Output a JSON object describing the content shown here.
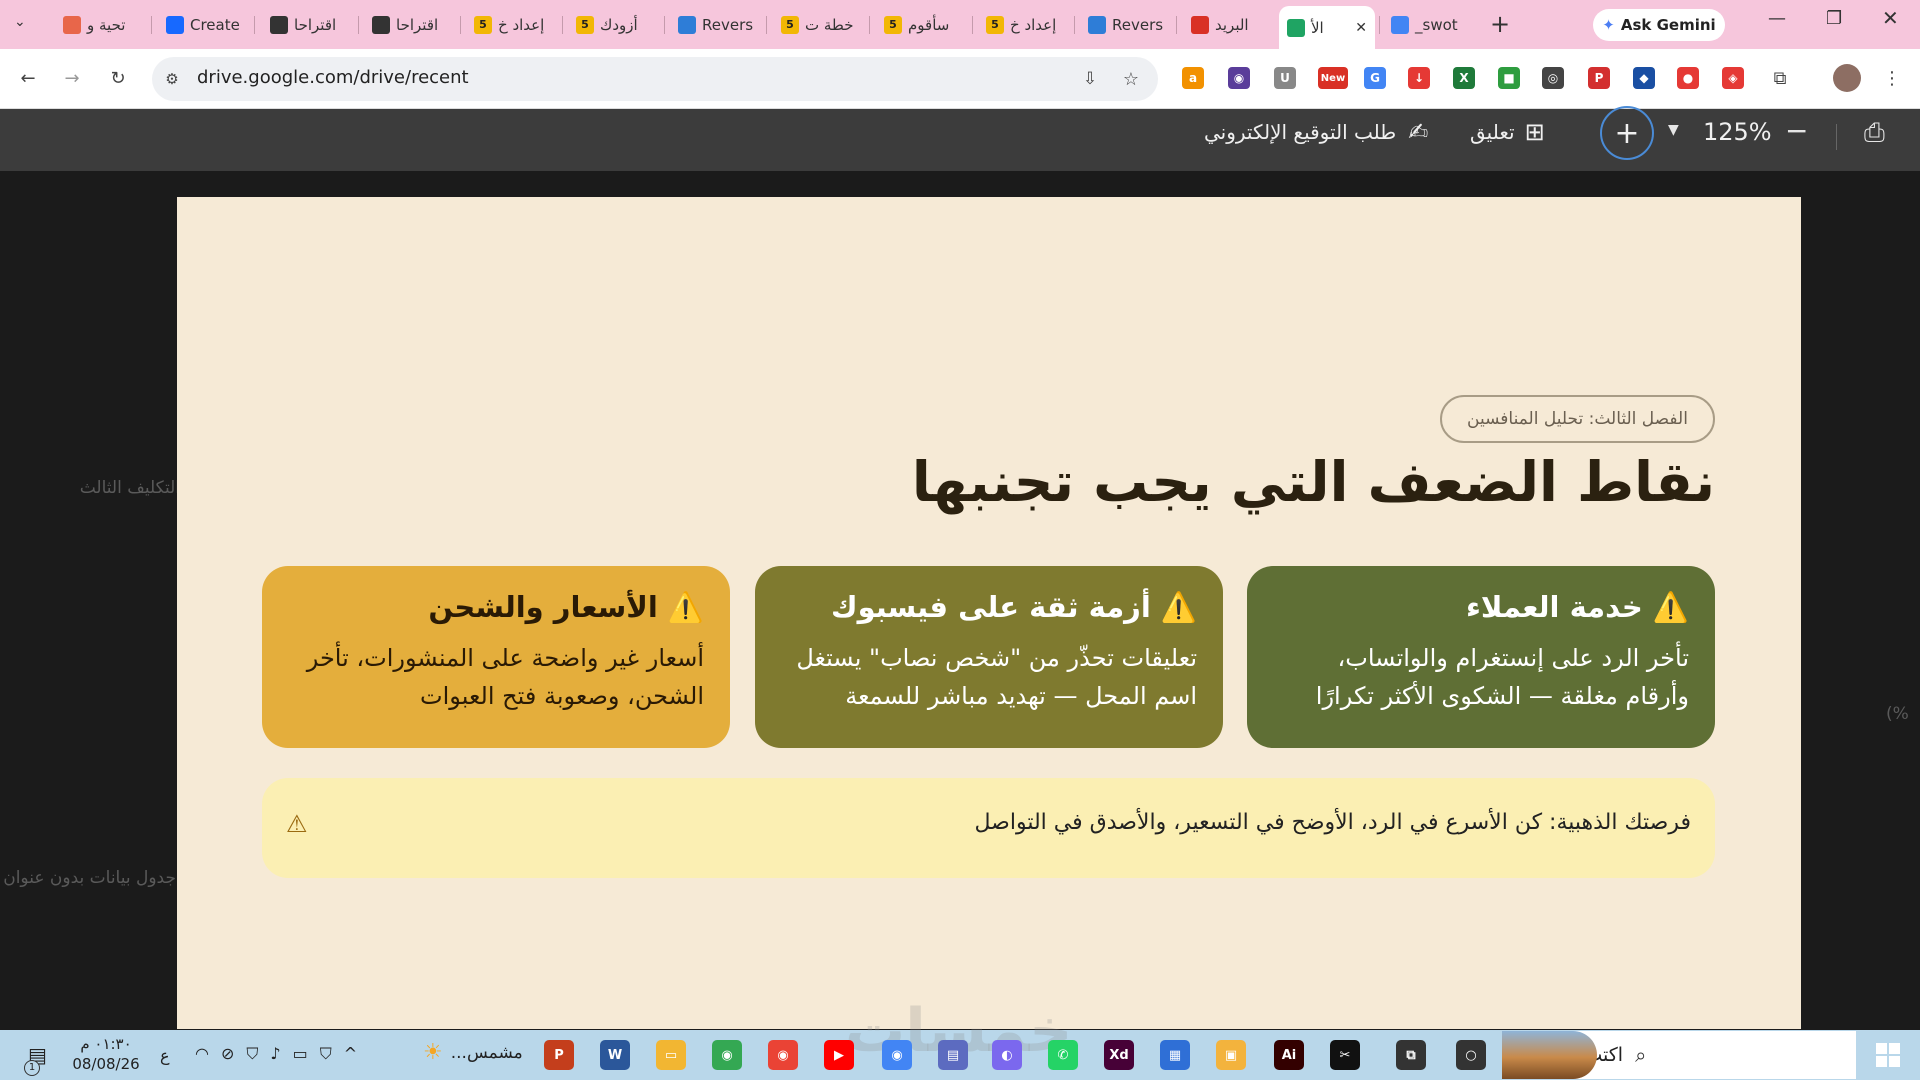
{
  "browser": {
    "tabs": [
      {
        "label": "تحية و",
        "icon": "sparkle-icon",
        "color": "#e8664a"
      },
      {
        "label": "Create",
        "icon": "behance-icon",
        "color": "#1769ff"
      },
      {
        "label": "اقتراحا",
        "icon": "openai-icon",
        "color": "#333333"
      },
      {
        "label": "اقتراحا",
        "icon": "openai-icon",
        "color": "#333333"
      },
      {
        "label": "إعداد خ",
        "icon": "five-icon",
        "color": "#f2b705"
      },
      {
        "label": "أزودك",
        "icon": "five-icon",
        "color": "#f2b705"
      },
      {
        "label": "Revers",
        "icon": "reverso-icon",
        "color": "#2e7dd7"
      },
      {
        "label": "خطة ت",
        "icon": "five-icon",
        "color": "#f2b705"
      },
      {
        "label": "سأقوم",
        "icon": "five-icon",
        "color": "#f2b705"
      },
      {
        "label": "إعداد خ",
        "icon": "five-icon",
        "color": "#f2b705"
      },
      {
        "label": "Revers",
        "icon": "reverso-icon",
        "color": "#2e7dd7"
      },
      {
        "label": "البريد",
        "icon": "gmail-icon",
        "color": "#d93025"
      },
      {
        "label": "الأ",
        "icon": "drive-icon",
        "color": "#1fa463",
        "active": true
      },
      {
        "label": "swot_",
        "icon": "docs-icon",
        "color": "#4285f4"
      }
    ],
    "five_glyph": "5",
    "new_tab_glyph": "+",
    "gemini_label": "Ask Gemini",
    "url": "drive.google.com/drive/recent",
    "extensions": [
      {
        "name": "amazon-extension-icon",
        "glyph": "a",
        "color": "#f29100"
      },
      {
        "name": "record-extension-icon",
        "glyph": "◉",
        "color": "#5a3d9a"
      },
      {
        "name": "u-extension-icon",
        "glyph": "U",
        "color": "#888888"
      },
      {
        "name": "new-extension-icon",
        "glyph": "New",
        "color": "#d93025"
      },
      {
        "name": "translate-extension-icon",
        "glyph": "G",
        "color": "#4285f4"
      },
      {
        "name": "download-extension-icon",
        "glyph": "↓",
        "color": "#e53935"
      },
      {
        "name": "excel-extension-icon",
        "glyph": "X",
        "color": "#1f7a3a"
      },
      {
        "name": "green-extension-icon",
        "glyph": "■",
        "color": "#2e9d3f"
      },
      {
        "name": "openai-extension-icon",
        "glyph": "◎",
        "color": "#444444"
      },
      {
        "name": "pdf-extension-icon",
        "glyph": "P",
        "color": "#d32f2f"
      },
      {
        "name": "blue-extension-icon",
        "glyph": "◆",
        "color": "#1a4fa3"
      },
      {
        "name": "pokeball-extension-icon",
        "glyph": "●",
        "color": "#e53935"
      },
      {
        "name": "shield-extension-icon",
        "glyph": "◈",
        "color": "#e53935"
      }
    ]
  },
  "pdf_toolbar": {
    "esign_label": "طلب التوقيع الإلكتروني",
    "comment_label": "تعليق",
    "zoom": "125%"
  },
  "slide": {
    "chapter_badge": "الفصل الثالث: تحليل المنافسين",
    "title": "نقاط الضعف التي يجب تجنبها",
    "cards": [
      {
        "title": "⚠️ خدمة العملاء",
        "text": "تأخر الرد على إنستغرام والواتساب، وأرقام مغلقة — الشكوى الأكثر تكرارًا",
        "bg": "#5f6f35",
        "fg": "#ffffff"
      },
      {
        "title": "⚠️ أزمة ثقة على فيسبوك",
        "text": "تعليقات تحذّر من \"شخص نصاب\" يستغل اسم المحل — تهديد مباشر للسمعة",
        "bg": "#7f7a2f",
        "fg": "#ffffff"
      },
      {
        "title": "⚠️ الأسعار والشحن",
        "text": "أسعار غير واضحة على المنشورات، تأخر الشحن، وصعوبة فتح العبوات",
        "bg": "#e4ae3c",
        "fg": "#2a1a05"
      }
    ],
    "note_text": "فرصتك الذهبية: كن الأسرع في الرد، الأوضح في التسعير، والأصدق في التواصل",
    "note_bg": "#fbefb3"
  },
  "background_fragments": {
    "left_text_1": "التكليف الثالث",
    "left_text_2": "جدول بيانات بدون عنوان",
    "right_text": "(%"
  },
  "taskbar": {
    "search_placeholder": "اكتب هنا للبحث",
    "weather_label": "مشمس...",
    "time": "٠١:٣٠ م",
    "date": "08/08/26",
    "lang": "ع",
    "notification_count": "1",
    "watermark": "خمسات",
    "apps": [
      {
        "name": "powerpoint-icon",
        "glyph": "P",
        "color": "#c43e1c"
      },
      {
        "name": "word-icon",
        "glyph": "W",
        "color": "#2b579a"
      },
      {
        "name": "file-explorer-icon",
        "glyph": "▭",
        "color": "#f2b632"
      },
      {
        "name": "chrome-icon",
        "glyph": "◉",
        "color": "#34a853"
      },
      {
        "name": "chrome-icon",
        "glyph": "◉",
        "color": "#ea4335"
      },
      {
        "name": "youtube-icon",
        "glyph": "▶",
        "color": "#ff0000"
      },
      {
        "name": "chrome-active-icon",
        "glyph": "◉",
        "color": "#4285f4"
      },
      {
        "name": "media-icon",
        "glyph": "▤",
        "color": "#5c6bc0"
      },
      {
        "name": "copilot-icon",
        "glyph": "◐",
        "color": "#7b68ee"
      },
      {
        "name": "whatsapp-icon",
        "glyph": "✆",
        "color": "#25d366"
      },
      {
        "name": "xd-icon",
        "glyph": "Xd",
        "color": "#470137"
      },
      {
        "name": "calendar-icon",
        "glyph": "▦",
        "color": "#2f6fd6"
      },
      {
        "name": "store-icon",
        "glyph": "▣",
        "color": "#f3b33d"
      },
      {
        "name": "illustrator-icon",
        "glyph": "Ai",
        "color": "#330000"
      },
      {
        "name": "capcut-icon",
        "glyph": "✂",
        "color": "#111111"
      },
      {
        "name": "taskview-icon",
        "glyph": "⧉",
        "color": "#333333"
      },
      {
        "name": "cortana-icon",
        "glyph": "○",
        "color": "#333333"
      }
    ]
  }
}
